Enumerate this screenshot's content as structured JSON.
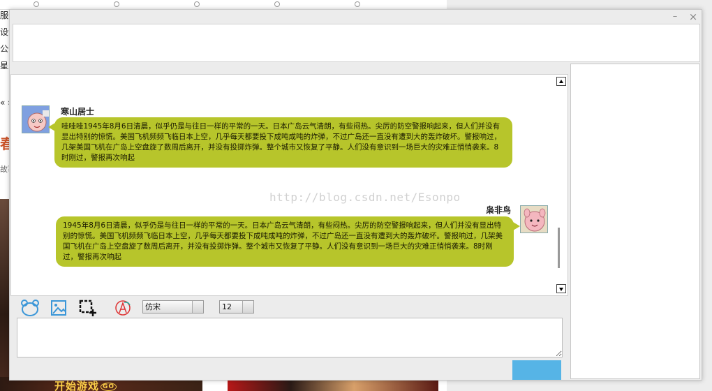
{
  "background": {
    "side_items": [
      "服务",
      "设计",
      "公告",
      "星入",
      "« »",
      "故事"
    ],
    "heading": "春",
    "game_label": "开始游戏",
    "game_go": "GO"
  },
  "window": {
    "minimize_glyph": "–",
    "close_glyph": "×"
  },
  "messages": [
    {
      "sender": "寒山居士",
      "side": "left",
      "text": "哇哇哇1945年8月6日清晨，似乎仍是与往日一样的平常的一天。日本广岛云气清朗，有些闷热。尖厉的防空警报响起来，但人们并没有显出特别的惊慌。美国飞机频频飞临日本上空，几乎每天都要投下成吨成吨的炸弹，不过广岛还一直没有遭到大的轰炸破坏。警报响过，几架美国飞机在广岛上空盘旋了数周后离开，并没有投掷炸弹。整个城市又恢复了平静。人们没有意识到一场巨大的灾难正悄悄袭来。8时刚过，警报再次响起"
    },
    {
      "sender": "枭非鸟",
      "side": "right",
      "text": "1945年8月6日清晨，似乎仍是与往日一样的平常的一天。日本广岛云气清朗，有些闷热。尖厉的防空警报响起来，但人们并没有显出特别的惊慌。美国飞机频频飞临日本上空，几乎每天都要投下成吨成吨的炸弹，不过广岛还一直没有遭到大的轰炸破坏。警报响过，几架美国飞机在广岛上空盘旋了数周后离开，并没有投掷炸弹。整个城市又恢复了平静。人们没有意识到一场巨大的灾难正悄悄袭来。8时刚过，警报再次响起"
    }
  ],
  "watermark": "http://blog.csdn.net/Esonpo",
  "toolbar": {
    "font_family": "仿宋",
    "font_size": "12",
    "icons": [
      "emoji-icon",
      "image-icon",
      "screenshot-icon",
      "text-style-icon"
    ]
  },
  "colors": {
    "bubble": "#b7c52b",
    "send_button": "#56b4e6"
  },
  "scroll_position": 0.9
}
